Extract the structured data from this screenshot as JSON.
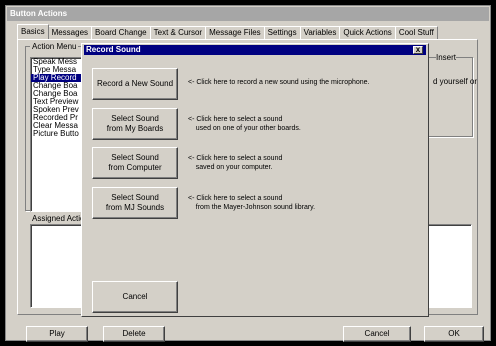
{
  "window": {
    "title": "Button Actions"
  },
  "tabs": [
    "Basics",
    "Messages",
    "Board Change",
    "Text & Cursor",
    "Message Files",
    "Settings",
    "Variables",
    "Quick Actions",
    "Cool Stuff"
  ],
  "action_menu": {
    "label": "Action Menu",
    "items": [
      "Speak Mess",
      "Type Messa",
      "Play Record",
      "Change Boa",
      "Change Boa",
      "Text Preview",
      "Spoken Prev",
      "Recorded Pr",
      "Clear Messa",
      "Picture Butto"
    ],
    "selected_index": 2
  },
  "right_panel": {
    "insert_label": "Insert",
    "partial_text": "d yourself or"
  },
  "assigned_actions": {
    "label": "Assigned Action"
  },
  "bottom_buttons": {
    "play": "Play",
    "delete": "Delete",
    "cancel": "Cancel",
    "ok": "OK"
  },
  "dialog": {
    "title": "Record Sound",
    "close": "x",
    "options": [
      {
        "label": "Record a New Sound",
        "description": "<- Click here to record a new sound using the microphone."
      },
      {
        "label": "Select Sound\nfrom My Boards",
        "description": "<- Click here to select a sound\n    used on one of your other boards."
      },
      {
        "label": "Select Sound\nfrom Computer",
        "description": "<- Click here to select a sound\n    saved on your computer."
      },
      {
        "label": "Select Sound\nfrom MJ Sounds",
        "description": "<- Click here to select a sound\n    from the Mayer-Johnson sound library."
      }
    ],
    "cancel": "Cancel"
  }
}
